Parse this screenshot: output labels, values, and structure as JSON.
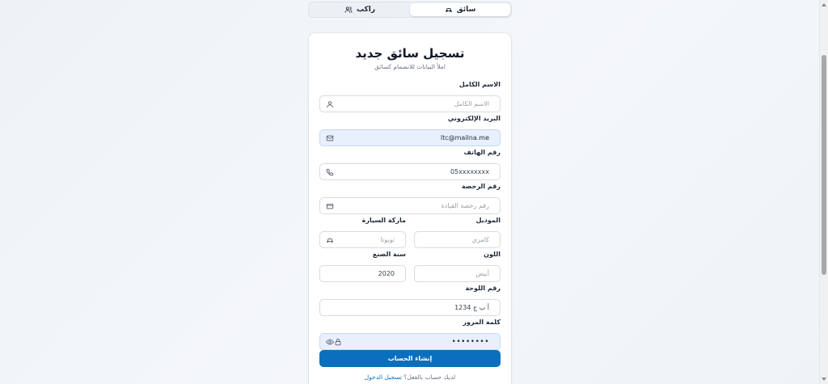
{
  "tabs": [
    {
      "label": "سائق",
      "icon": "car-icon",
      "active": true
    },
    {
      "label": "راكب",
      "icon": "users-icon",
      "active": false
    }
  ],
  "form": {
    "title": "تسجيل سائق جديد",
    "subtitle": "املأ البيانات للانضمام كسائق",
    "full_name": {
      "label": "الاسم الكامل",
      "placeholder": "الاسم الكامل",
      "value": ""
    },
    "email": {
      "label": "البريد الإلكتروني",
      "value": "ltc@mailna.me"
    },
    "phone": {
      "label": "رقم الهاتف",
      "placeholder": "05xxxxxxxx"
    },
    "license": {
      "label": "رقم الرخصة",
      "placeholder": "رقم رخصة القيادة"
    },
    "car_make": {
      "label": "ماركة السيارة",
      "placeholder": "تويوتا"
    },
    "model": {
      "label": "الموديل",
      "placeholder": "كامري"
    },
    "year": {
      "label": "سنة الصنع",
      "placeholder": "2020"
    },
    "color": {
      "label": "اللون",
      "placeholder": "أبيض"
    },
    "plate": {
      "label": "رقم اللوحة",
      "placeholder": "أ ب ج 1234"
    },
    "password": {
      "label": "كلمة المرور",
      "value": "••••••••"
    },
    "submit_label": "إنشاء الحساب",
    "footer_text": "لديك حساب بالفعل؟",
    "footer_link": "تسجيل الدخول"
  },
  "colors": {
    "accent": "#0a6fbd",
    "autofill_bg": "#e8f0fe"
  }
}
